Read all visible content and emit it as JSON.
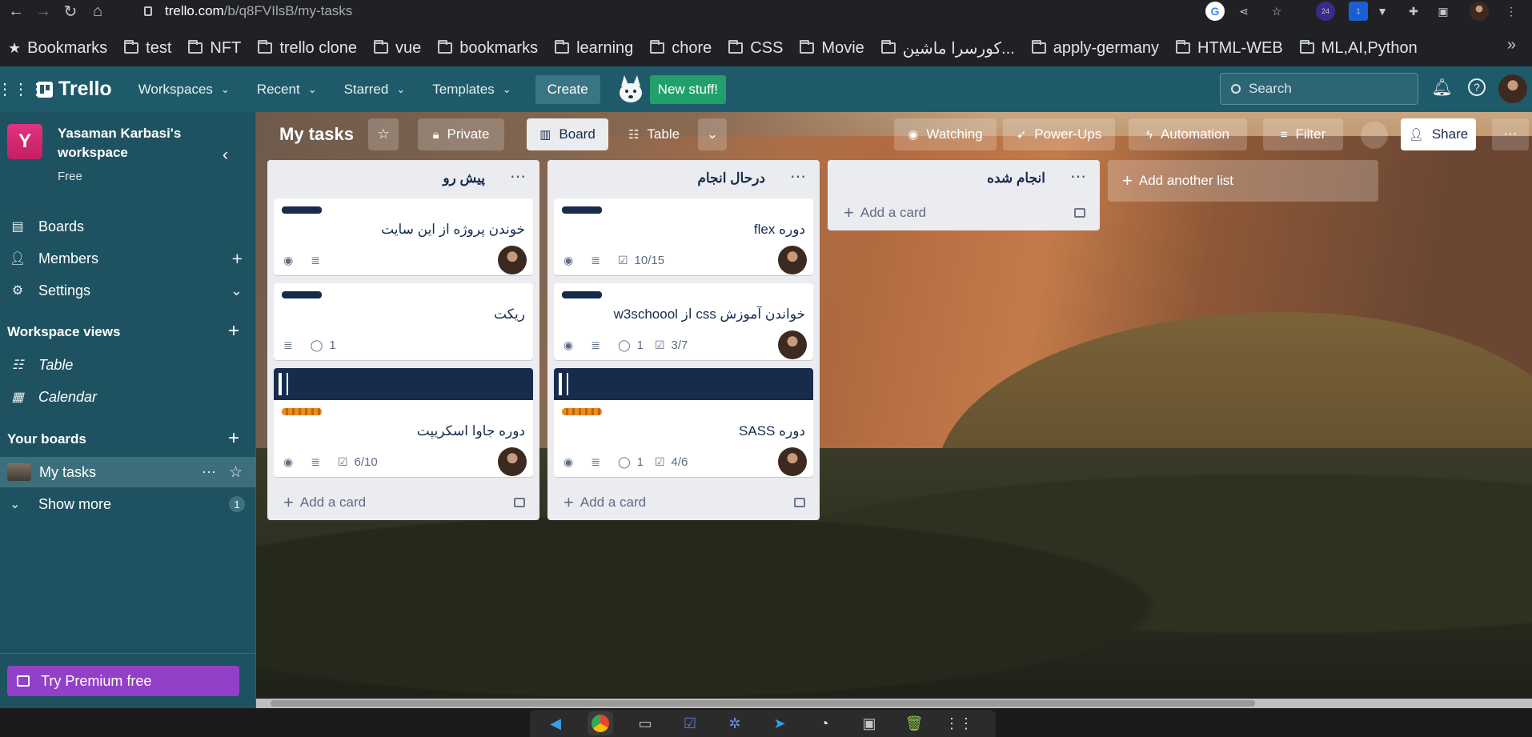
{
  "browser": {
    "url_host": "trello.com",
    "url_path": "/b/q8FVIlsB/my-tasks",
    "bookmarks_label": "Bookmarks",
    "bookmarks": [
      "test",
      "NFT",
      "trello clone",
      "vue",
      "bookmarks",
      "learning",
      "chore",
      "CSS",
      "Movie",
      "کورسرا ماشین...",
      "apply-germany",
      "HTML-WEB",
      "ML,AI,Python"
    ],
    "ext_badges": [
      "24",
      "1"
    ]
  },
  "topbar": {
    "logo": "Trello",
    "menus": [
      "Workspaces",
      "Recent",
      "Starred",
      "Templates"
    ],
    "create": "Create",
    "new_stuff": "New stuff!",
    "search_placeholder": "Search"
  },
  "sidebar": {
    "workspace_initial": "Y",
    "workspace_name": "Yasaman Karbasi's workspace",
    "workspace_plan": "Free",
    "nav": [
      "Boards",
      "Members",
      "Settings"
    ],
    "views_heading": "Workspace views",
    "views": [
      "Table",
      "Calendar"
    ],
    "your_boards": "Your boards",
    "board_item": "My tasks",
    "show_more": "Show more",
    "show_more_count": "1",
    "premium": "Try Premium free"
  },
  "board": {
    "title": "My tasks",
    "visibility": "Private",
    "view_board": "Board",
    "view_table": "Table",
    "watching": "Watching",
    "powerups": "Power-Ups",
    "automation": "Automation",
    "filter": "Filter",
    "share": "Share",
    "add_another_list": "Add another list",
    "add_card": "Add a card"
  },
  "lists": [
    {
      "name": "پیش رو",
      "cards": [
        {
          "title": "خوندن پروژه از این سایت",
          "label": "navy",
          "cover": false,
          "watch": true,
          "desc": true,
          "comments": "",
          "checklist": ""
        },
        {
          "title": "ریکت",
          "label": "navy",
          "cover": false,
          "watch": false,
          "desc": true,
          "comments": "1",
          "checklist": ""
        },
        {
          "title": "دوره جاوا اسکریپت",
          "label": "orange",
          "cover": true,
          "watch": true,
          "desc": true,
          "comments": "",
          "checklist": "6/10"
        }
      ]
    },
    {
      "name": "درحال انجام",
      "cards": [
        {
          "title": "دوره flex",
          "label": "navy",
          "cover": false,
          "watch": true,
          "desc": true,
          "comments": "",
          "checklist": "10/15"
        },
        {
          "title": "خواندن آموزش css از w3schoool",
          "label": "navy",
          "cover": false,
          "watch": true,
          "desc": true,
          "comments": "1",
          "checklist": "3/7"
        },
        {
          "title": "دوره SASS",
          "label": "orange",
          "cover": true,
          "watch": true,
          "desc": true,
          "comments": "1",
          "checklist": "4/6"
        }
      ]
    },
    {
      "name": "انجام شده",
      "cards": []
    }
  ],
  "colors": {
    "topbar": "#1f5a6b",
    "sidebar": "#1e5261",
    "premium": "#9340c9",
    "new_stuff": "#22a06b",
    "label_navy": "#172b4d",
    "label_orange": "#f18a1d"
  }
}
